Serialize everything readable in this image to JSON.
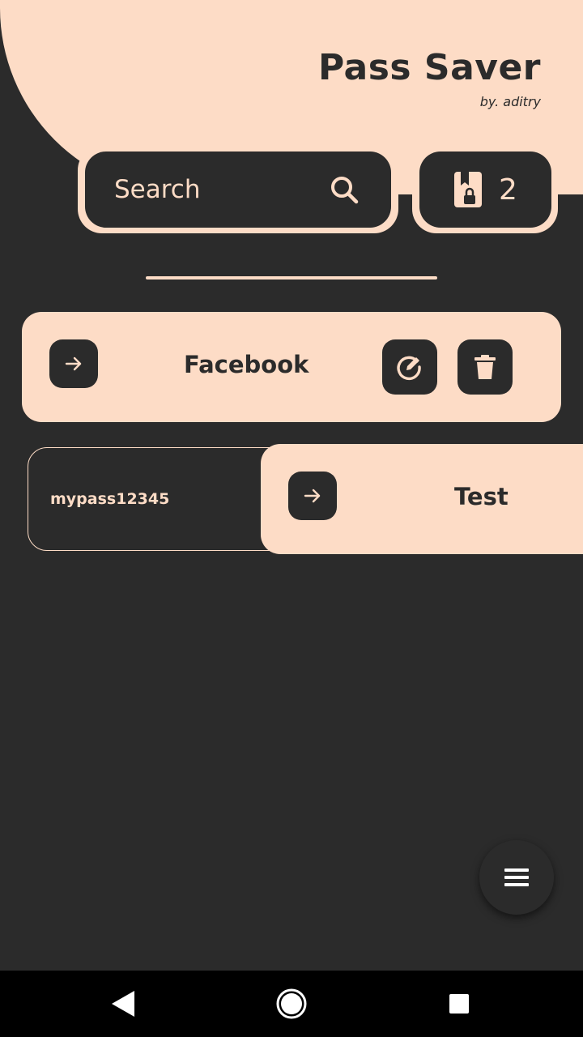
{
  "header": {
    "title": "Pass Saver",
    "byline": "by. aditry"
  },
  "search": {
    "label": "Search",
    "icon": "search-icon"
  },
  "counter": {
    "icon": "bookmark-lock-icon",
    "count": "2"
  },
  "entries": [
    {
      "title": "Facebook",
      "open_icon": "arrow-right-icon",
      "edit_icon": "edit-icon",
      "delete_icon": "trash-icon"
    },
    {
      "title": "Test",
      "open_icon": "arrow-right-icon",
      "revealed_password": "mypass12345"
    }
  ],
  "fab": {
    "icon": "menu-icon"
  },
  "navbar": {
    "back_icon": "back-icon",
    "home_icon": "home-icon",
    "recents_icon": "recents-icon"
  },
  "colors": {
    "background": "#2b2b2b",
    "accent": "#fddcc6",
    "navbar": "#000000"
  }
}
